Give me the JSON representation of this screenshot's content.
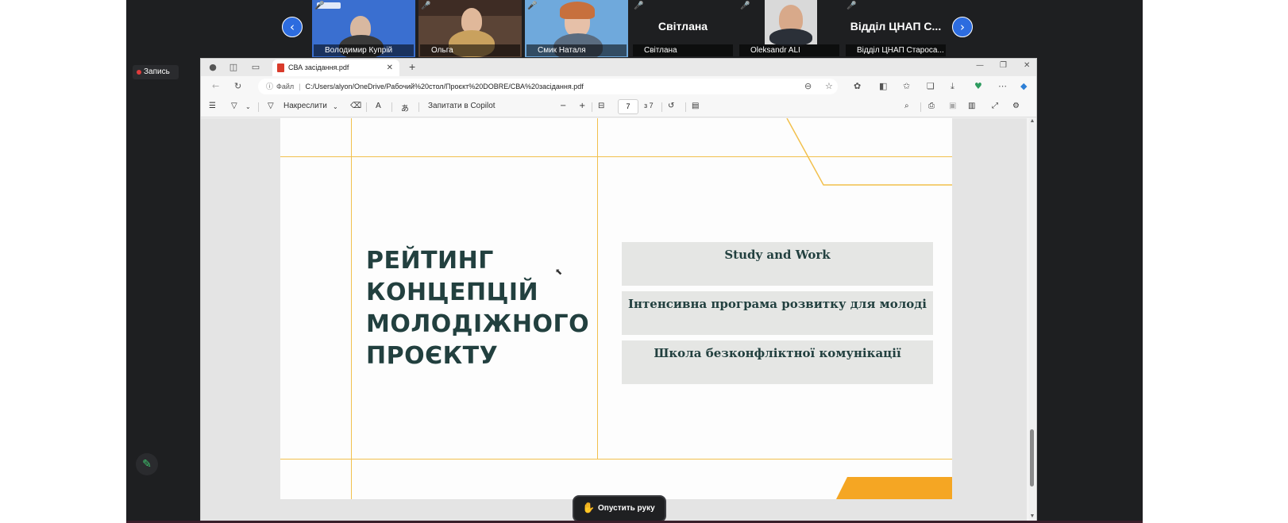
{
  "participants": [
    {
      "name": "Володимир Купрій",
      "muted": true
    },
    {
      "name": "Ольга",
      "muted": true
    },
    {
      "name": "Смик Наталя",
      "muted": true
    },
    {
      "name": "Світлана",
      "muted": true,
      "display_name": "Світлана"
    },
    {
      "name": "Oleksandr ALI",
      "muted": true
    },
    {
      "name": "Відділ ЦНАП Староса...",
      "muted": true,
      "display_name": "Відділ ЦНАП С..."
    }
  ],
  "meeting": {
    "record_label": "Запись",
    "raise_hand_label": "Опустить руку",
    "accent": "#2d6cdf"
  },
  "browser": {
    "tab_title": "СВА засідання.pdf",
    "address_scheme": "Файл",
    "address_url": "C:/Users/alyon/OneDrive/Рабочий%20стол/Проєкт%20DOBRE/СВА%20засідання.pdf"
  },
  "pdf_toolbar": {
    "draw_label": "Накреслити",
    "copilot_label": "Запитати в Copilot",
    "page_current": "7",
    "page_total": "з 7"
  },
  "slide": {
    "title_lines": [
      "РЕЙТИНГ",
      "КОНЦЕПЦІЙ",
      "МОЛОДІЖНОГО",
      "ПРОЄКТУ"
    ],
    "concepts": [
      "Study and Work",
      "Інтенсивна програма розвитку для молоді",
      "Школа безконфліктної комунікації"
    ],
    "text_color": "#22403f",
    "line_color": "#f2c04d",
    "accent_orange": "#f5a623"
  }
}
